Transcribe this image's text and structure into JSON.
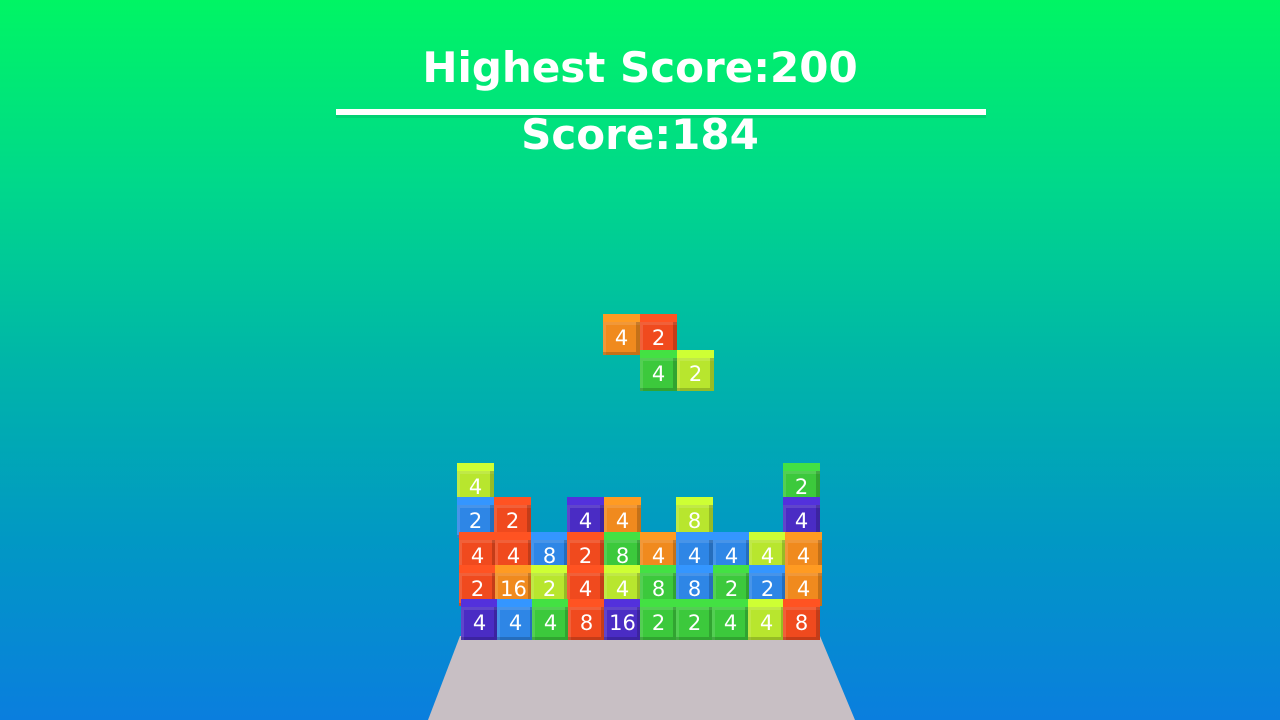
{
  "hud": {
    "highest_score": "Highest Score:200",
    "score": "Score:184"
  },
  "colors": {
    "orange": "#f08a1e",
    "red": "#f04a1e",
    "green": "#3cc93c",
    "lime": "#b8e62e",
    "blue": "#2e86e6",
    "purple": "#4a2cc4",
    "platform": "#c8bfc4"
  },
  "falling_piece": [
    {
      "value": "4",
      "color": "orange"
    },
    {
      "value": "2",
      "color": "red"
    },
    {
      "value": "4",
      "color": "green"
    },
    {
      "value": "2",
      "color": "lime"
    }
  ],
  "stack": [
    {
      "value": "4",
      "color": "lime"
    },
    {
      "value": "2",
      "color": "green"
    },
    {
      "value": "2",
      "color": "blue"
    },
    {
      "value": "2",
      "color": "red"
    },
    {
      "value": "4",
      "color": "purple"
    },
    {
      "value": "4",
      "color": "orange"
    },
    {
      "value": "8",
      "color": "lime"
    },
    {
      "value": "4",
      "color": "purple"
    },
    {
      "value": "4",
      "color": "red"
    },
    {
      "value": "4",
      "color": "red"
    },
    {
      "value": "8",
      "color": "blue"
    },
    {
      "value": "2",
      "color": "red"
    },
    {
      "value": "8",
      "color": "green"
    },
    {
      "value": "4",
      "color": "orange"
    },
    {
      "value": "4",
      "color": "blue"
    },
    {
      "value": "4",
      "color": "blue"
    },
    {
      "value": "4",
      "color": "lime"
    },
    {
      "value": "4",
      "color": "orange"
    },
    {
      "value": "2",
      "color": "red"
    },
    {
      "value": "16",
      "color": "orange"
    },
    {
      "value": "2",
      "color": "lime"
    },
    {
      "value": "4",
      "color": "red"
    },
    {
      "value": "4",
      "color": "lime"
    },
    {
      "value": "8",
      "color": "green"
    },
    {
      "value": "8",
      "color": "blue"
    },
    {
      "value": "2",
      "color": "green"
    },
    {
      "value": "2",
      "color": "blue"
    },
    {
      "value": "4",
      "color": "orange"
    },
    {
      "value": "4",
      "color": "purple"
    },
    {
      "value": "4",
      "color": "blue"
    },
    {
      "value": "4",
      "color": "green"
    },
    {
      "value": "8",
      "color": "red"
    },
    {
      "value": "16",
      "color": "purple"
    },
    {
      "value": "2",
      "color": "green"
    },
    {
      "value": "2",
      "color": "green"
    },
    {
      "value": "4",
      "color": "green"
    },
    {
      "value": "4",
      "color": "lime"
    },
    {
      "value": "8",
      "color": "red"
    }
  ]
}
